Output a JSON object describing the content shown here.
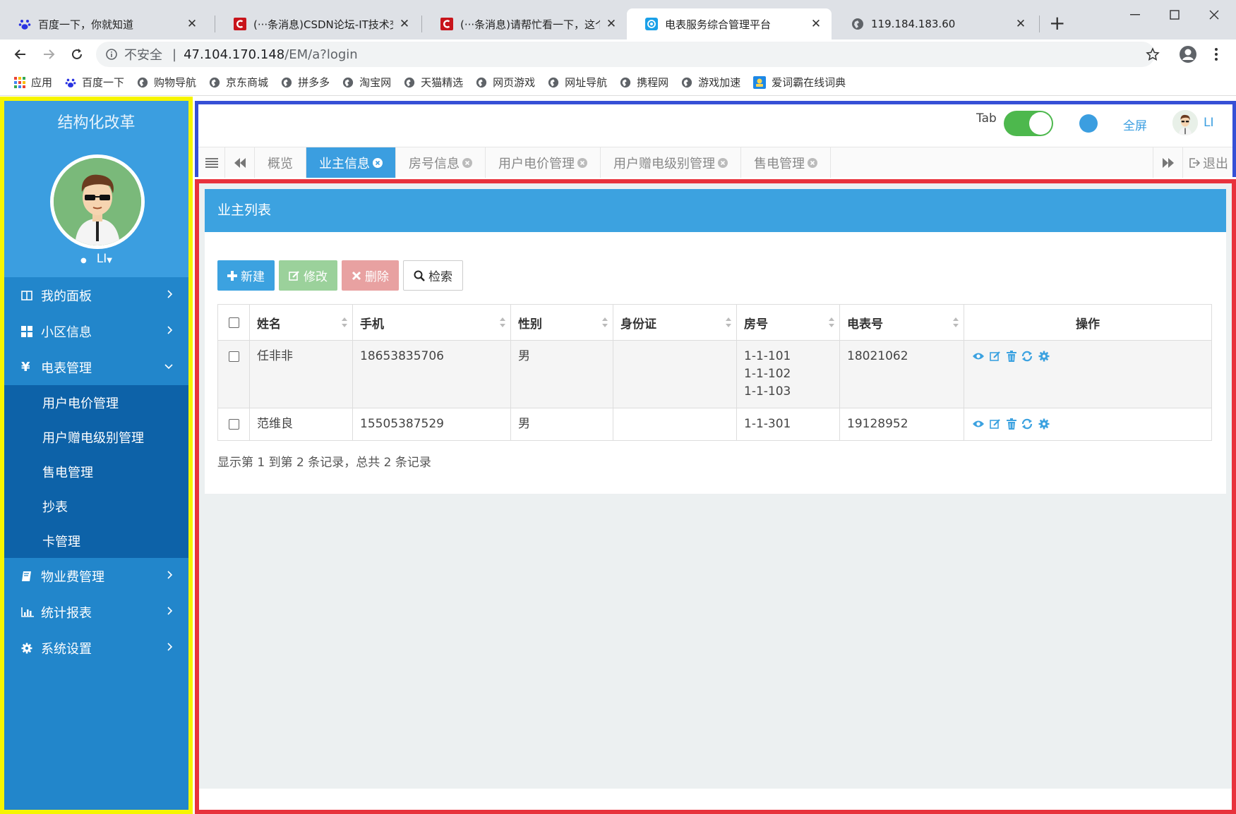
{
  "browser": {
    "tabs": [
      {
        "title": "百度一下，你就知道"
      },
      {
        "title": "(···条消息)CSDN论坛-IT技术交流"
      },
      {
        "title": "(···条消息)请帮忙看一下，这个窗"
      },
      {
        "title": "电表服务综合管理平台"
      },
      {
        "title": "119.184.183.60"
      }
    ],
    "close_glyph": "✕",
    "new_tab": "+",
    "address": {
      "insecure_label": "不安全",
      "separator": "|",
      "host": "47.104.170.148",
      "path": "/EM/a?login"
    },
    "bookmarks": [
      "应用",
      "百度一下",
      "购物导航",
      "京东商城",
      "拼多多",
      "淘宝网",
      "天猫精选",
      "网页游戏",
      "网址导航",
      "携程网",
      "游戏加速",
      "爱词霸在线词典"
    ]
  },
  "sidebar": {
    "title": "结构化改革",
    "username": "LI",
    "menu": [
      {
        "label": "我的面板",
        "icon": "columns-icon"
      },
      {
        "label": "小区信息",
        "icon": "grid-icon"
      },
      {
        "label": "电表管理",
        "icon": "yen-icon",
        "open": true
      },
      {
        "label": "物业费管理",
        "icon": "book-icon"
      },
      {
        "label": "统计报表",
        "icon": "bar-chart-icon"
      },
      {
        "label": "系统设置",
        "icon": "gear-icon"
      }
    ],
    "yen_glyph": "¥",
    "submenu": [
      "用户电价管理",
      "用户赠电级别管理",
      "售电管理",
      "抄表",
      "卡管理"
    ]
  },
  "topbar": {
    "tab_label": "Tab",
    "fullscreen_label": "全屏",
    "username": "LI",
    "exit_label": "退出"
  },
  "page_tabs": [
    {
      "label": "概览",
      "closable": false
    },
    {
      "label": "业主信息",
      "closable": true,
      "active": true
    },
    {
      "label": "房号信息",
      "closable": true
    },
    {
      "label": "用户电价管理",
      "closable": true
    },
    {
      "label": "用户赠电级别管理",
      "closable": true
    },
    {
      "label": "售电管理",
      "closable": true
    }
  ],
  "panel": {
    "title": "业主列表",
    "buttons": {
      "new": "新建",
      "edit": "修改",
      "delete": "删除",
      "search": "检索"
    },
    "columns": [
      "姓名",
      "手机",
      "性别",
      "身份证",
      "房号",
      "电表号",
      "操作"
    ],
    "rows": [
      {
        "name": "任非非",
        "phone": "18653835706",
        "gender": "男",
        "id_card": "",
        "rooms": [
          "1-1-101",
          "1-1-102",
          "1-1-103"
        ],
        "meter": "18021062"
      },
      {
        "name": "范维良",
        "phone": "15505387529",
        "gender": "男",
        "id_card": "",
        "rooms": [
          "1-1-301"
        ],
        "meter": "19128952"
      }
    ],
    "pager_info": "显示第 1 到第 2 条记录，总共 2 条记录"
  },
  "colors": {
    "sidebar": "#2286cb",
    "accent": "#3ca2e0",
    "yellow_frame": "#f6f500",
    "blue_frame": "#3650d6",
    "red_frame": "#e8323c"
  }
}
